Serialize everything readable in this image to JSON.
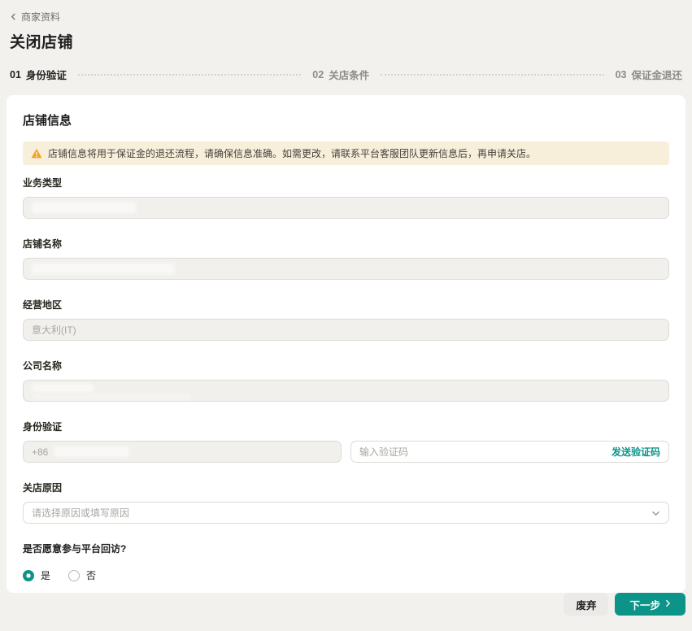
{
  "page": {
    "breadcrumb": "商家资料",
    "title": "关闭店铺"
  },
  "steps": [
    {
      "num": "01",
      "label": "身份验证",
      "active": true
    },
    {
      "num": "02",
      "label": "关店条件",
      "active": false
    },
    {
      "num": "03",
      "label": "保证金退还",
      "active": false
    }
  ],
  "card": {
    "title": "店铺信息",
    "warning_text": "店铺信息将用于保证金的退还流程，请确保信息准确。如需更改，请联系平台客服团队更新信息后，再申请关店。",
    "fields": {
      "business_type_label": "业务类型",
      "shop_name_label": "店铺名称",
      "region_label": "经营地区",
      "region_value": "意大利(IT)",
      "company_name_label": "公司名称",
      "identity_label": "身份验证",
      "phone_prefix": "+86",
      "code_placeholder": "输入验证码",
      "send_code_label": "发送验证码",
      "reason_label": "关店原因",
      "reason_placeholder": "请选择原因或填写原因",
      "survey_label": "是否愿意参与平台回访?",
      "radio_yes_label": "是",
      "radio_no_label": "否"
    }
  },
  "footer": {
    "discard_label": "废弃",
    "next_label": "下一步"
  },
  "colors": {
    "accent_teal": "#0d9488",
    "warning_bg": "#f8efdb",
    "warning_icon": "#f0a41d",
    "page_bg": "#f2f1ee"
  }
}
